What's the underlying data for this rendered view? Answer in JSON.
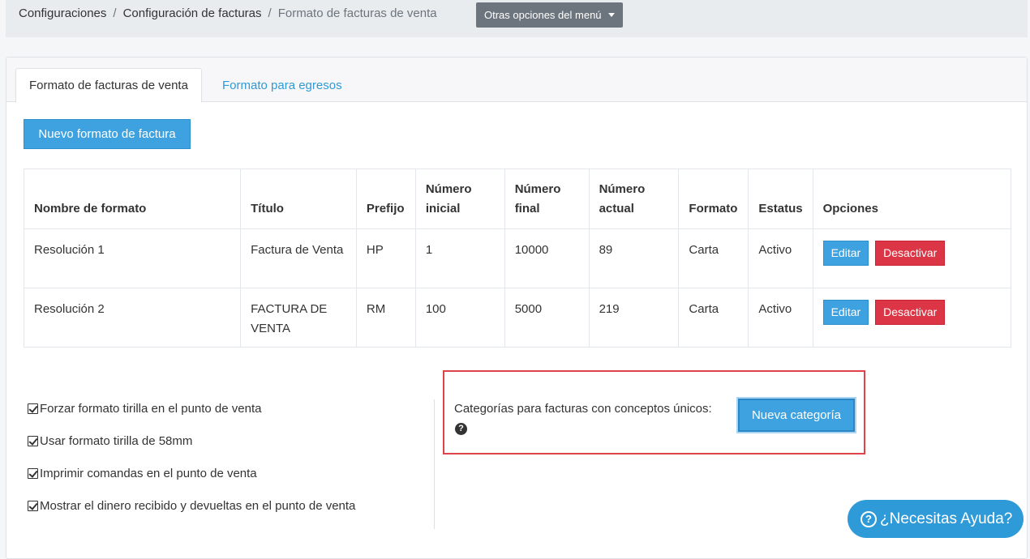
{
  "breadcrumb": {
    "items": [
      "Configuraciones",
      "Configuración de facturas"
    ],
    "separator": "/",
    "current": "Formato de facturas de venta"
  },
  "menu_button": {
    "label": "Otras opciones del menú"
  },
  "tabs": [
    {
      "label": "Formato de facturas de venta",
      "active": true
    },
    {
      "label": "Formato para egresos",
      "active": false
    }
  ],
  "new_format_button": {
    "label": "Nuevo formato de factura"
  },
  "table": {
    "headers": [
      "Nombre de formato",
      "Título",
      "Prefijo",
      "Número inicial",
      "Número final",
      "Número actual",
      "Formato",
      "Estatus",
      "Opciones"
    ],
    "rows": [
      {
        "nombre": "Resolución 1",
        "titulo": "Factura de Venta",
        "prefijo": "HP",
        "inicial": "1",
        "final": "10000",
        "actual": "89",
        "formato": "Carta",
        "estatus": "Activo"
      },
      {
        "nombre": "Resolución 2",
        "titulo": "FACTURA DE VENTA",
        "prefijo": "RM",
        "inicial": "100",
        "final": "5000",
        "actual": "219",
        "formato": "Carta",
        "estatus": "Activo"
      }
    ],
    "edit_label": "Editar",
    "deactivate_label": "Desactivar"
  },
  "checkboxes": [
    {
      "label": "Forzar formato tirilla en el punto de venta",
      "checked": true
    },
    {
      "label": "Usar formato tirilla de 58mm",
      "checked": true
    },
    {
      "label": "Imprimir comandas en el punto de venta",
      "checked": true
    },
    {
      "label": "Mostrar el dinero recibido y devueltas en el punto de venta",
      "checked": true
    }
  ],
  "categories": {
    "label": "Categorías para facturas con conceptos únicos:",
    "button_label": "Nueva categoría",
    "help_icon": "question-circle-icon"
  },
  "help_fab": {
    "label": "¿Necesitas Ayuda?",
    "icon": "question-circle-icon"
  },
  "colors": {
    "primary": "#3ea2e0",
    "danger": "#dc3545",
    "secondary": "#6c757d",
    "highlight_border": "#e0424a",
    "link": "#2e9ad8"
  }
}
